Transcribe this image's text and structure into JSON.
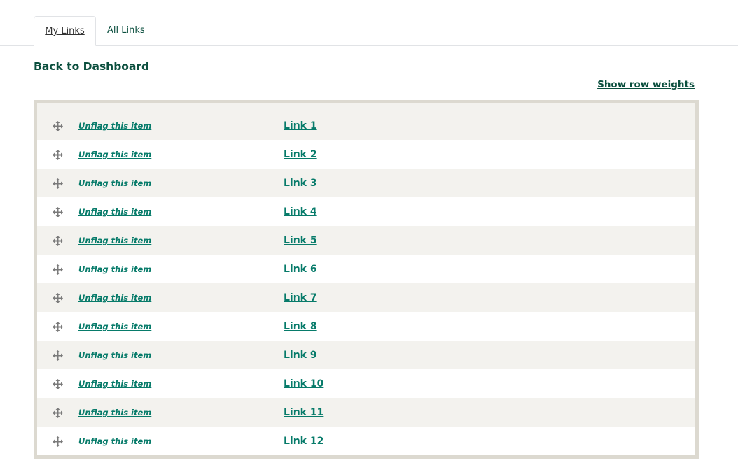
{
  "tabs": [
    {
      "label": "My Links",
      "active": true
    },
    {
      "label": "All Links",
      "active": false
    }
  ],
  "back_link": "Back to Dashboard",
  "show_row_weights": "Show row weights",
  "rows": [
    {
      "action": "Unflag this item",
      "link": "Link 1"
    },
    {
      "action": "Unflag this item",
      "link": "Link 2"
    },
    {
      "action": "Unflag this item",
      "link": "Link 3"
    },
    {
      "action": "Unflag this item",
      "link": "Link 4"
    },
    {
      "action": "Unflag this item",
      "link": "Link 5"
    },
    {
      "action": "Unflag this item",
      "link": "Link 6"
    },
    {
      "action": "Unflag this item",
      "link": "Link 7"
    },
    {
      "action": "Unflag this item",
      "link": "Link 8"
    },
    {
      "action": "Unflag this item",
      "link": "Link 9"
    },
    {
      "action": "Unflag this item",
      "link": "Link 10"
    },
    {
      "action": "Unflag this item",
      "link": "Link 11"
    },
    {
      "action": "Unflag this item",
      "link": "Link 12"
    }
  ],
  "icons": {
    "row_handle": "drag-move-icon"
  },
  "colors": {
    "link": "#077b6a",
    "dark_link": "#0b4f3e",
    "border": "#dcd9d0",
    "odd_row": "#f3f2ee"
  }
}
